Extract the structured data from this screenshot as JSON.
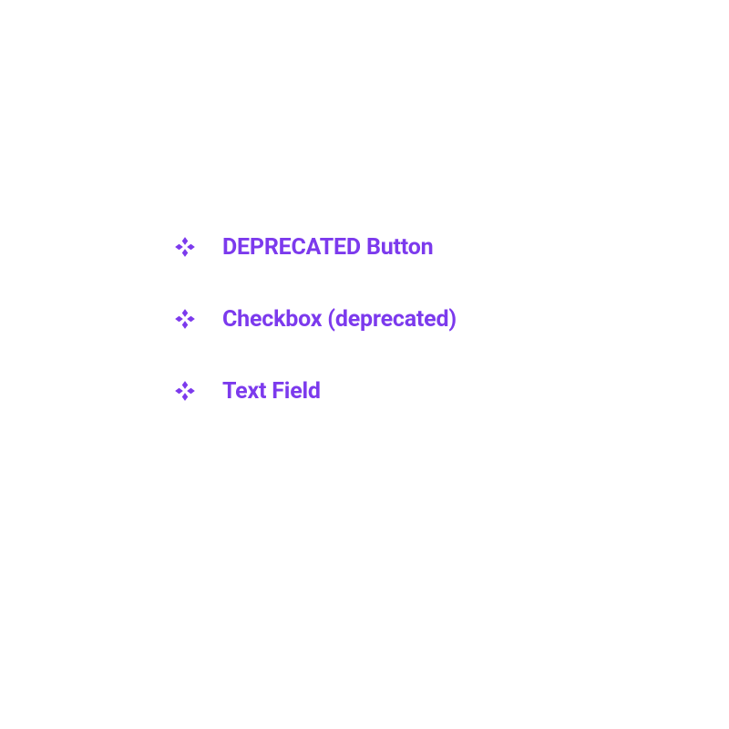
{
  "colors": {
    "accent": "#7C3AED"
  },
  "components": [
    {
      "label": "DEPRECATED Button",
      "icon": "component-icon"
    },
    {
      "label": "Checkbox (deprecated)",
      "icon": "component-icon"
    },
    {
      "label": "Text Field",
      "icon": "component-icon"
    }
  ]
}
